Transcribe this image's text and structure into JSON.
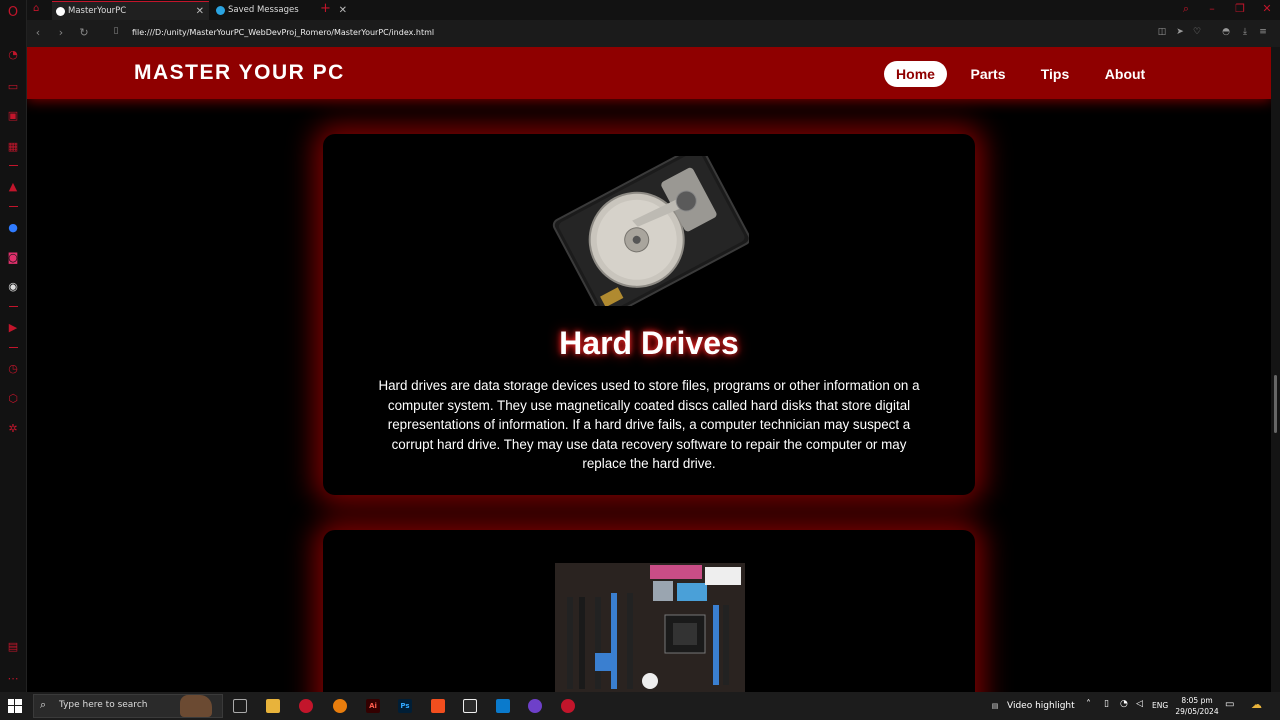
{
  "browser": {
    "tabs": [
      {
        "title": "MasterYourPC",
        "active": true
      },
      {
        "title": "Saved Messages",
        "active": false
      }
    ],
    "url": "file:///D:/unity/MasterYourPC_WebDevProj_Romero/MasterYourPC/index.html",
    "accent_color": "#c2152b"
  },
  "site": {
    "logo": "MASTER YOUR PC",
    "nav": {
      "home": "Home",
      "parts": "Parts",
      "tips": "Tips",
      "about": "About"
    },
    "active_nav": "Home",
    "header_color": "#8f0000"
  },
  "cards": [
    {
      "image": "hard-drive-image",
      "title": "Hard Drives",
      "text": "Hard drives are data storage devices used to store files, programs or other information on a computer system. They use magnetically coated discs called hard disks that store digital representations of information. If a hard drive fails, a computer technician may suspect a corrupt hard drive. They may use data recovery software to repair the computer or may replace the hard drive."
    },
    {
      "image": "motherboard-image"
    }
  ],
  "taskbar": {
    "search_placeholder": "Type here to search",
    "tray_label": "Video highlight",
    "language": "ENG",
    "time": "8:05 pm",
    "date": "29/05/2024"
  }
}
